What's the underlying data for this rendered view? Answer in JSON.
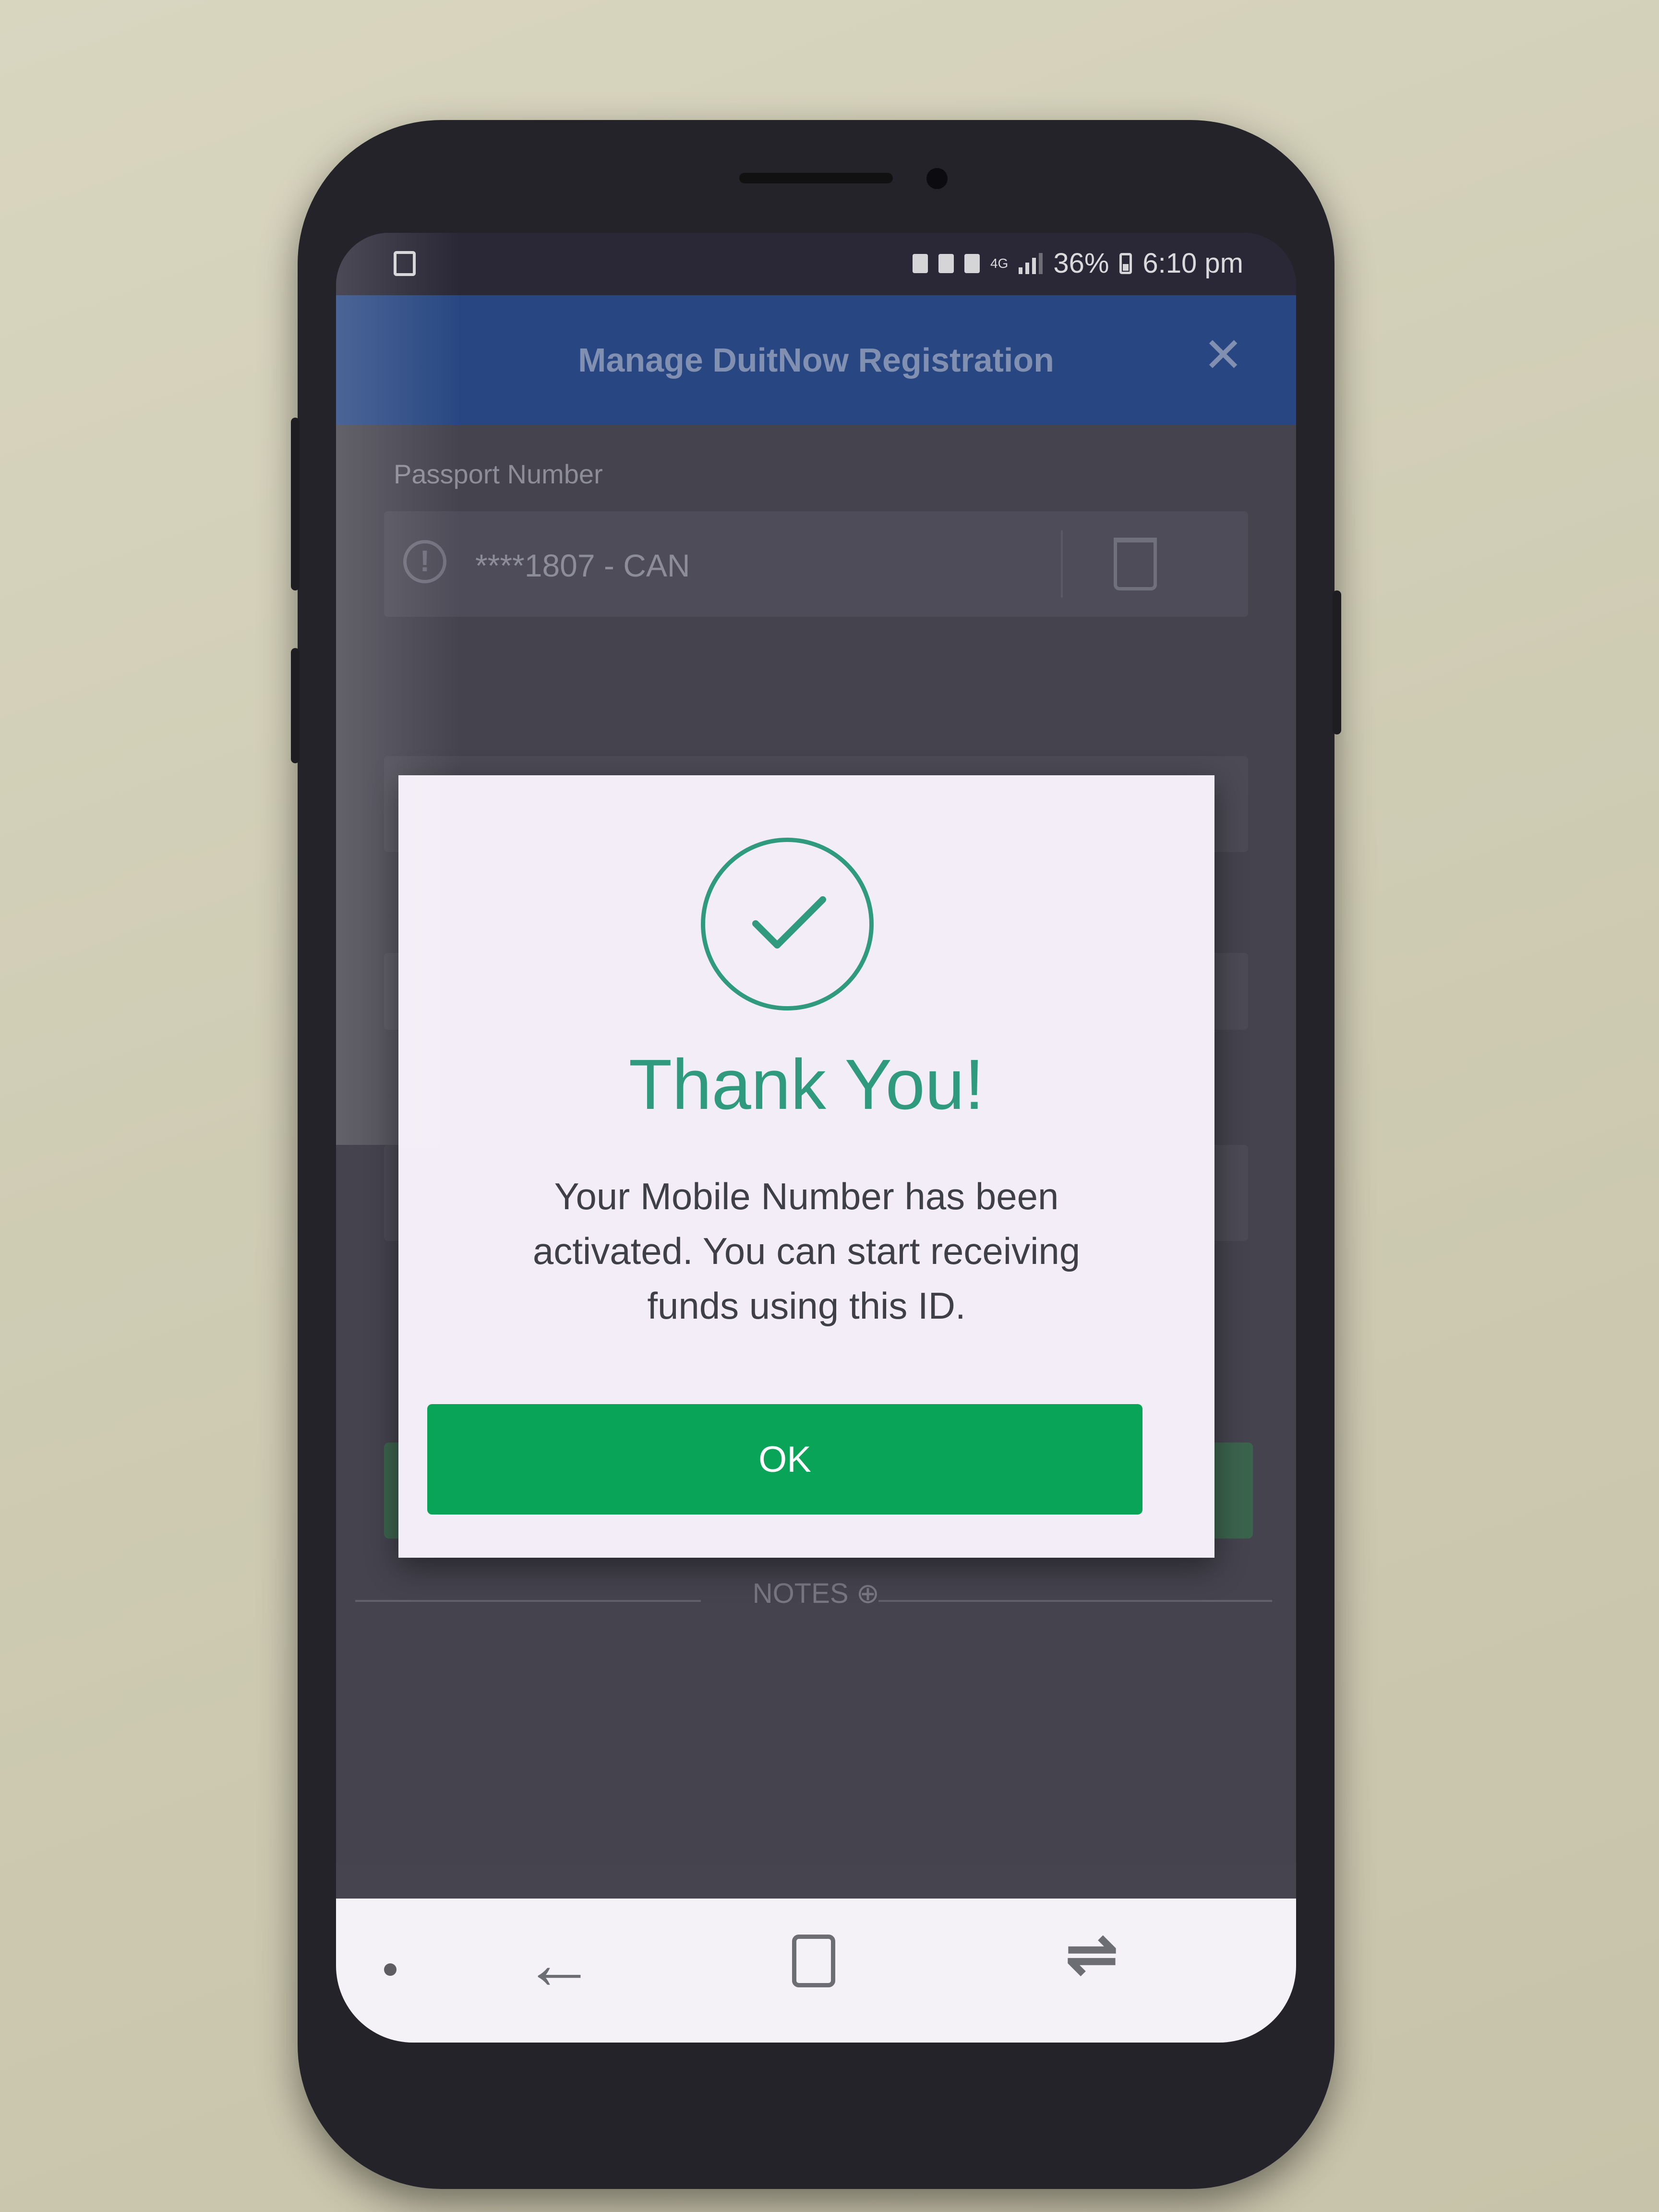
{
  "status_bar": {
    "battery_percent": "36%",
    "time": "6:10 pm",
    "network": "4G"
  },
  "header": {
    "title": "Manage DuitNow Registration",
    "close_icon": "close-icon"
  },
  "form": {
    "field_label": "Passport Number",
    "field_value": "****1807 - CAN"
  },
  "notes": {
    "label": "NOTES ⊕"
  },
  "dialog": {
    "icon": "checkmark-circle-icon",
    "title": "Thank You!",
    "message": "Your Mobile Number has been activated. You can start receiving funds using this ID.",
    "ok_label": "OK"
  },
  "colors": {
    "header_bg": "#2a4e8f",
    "accent_green": "#2f9a7e",
    "button_green": "#0aa458"
  }
}
